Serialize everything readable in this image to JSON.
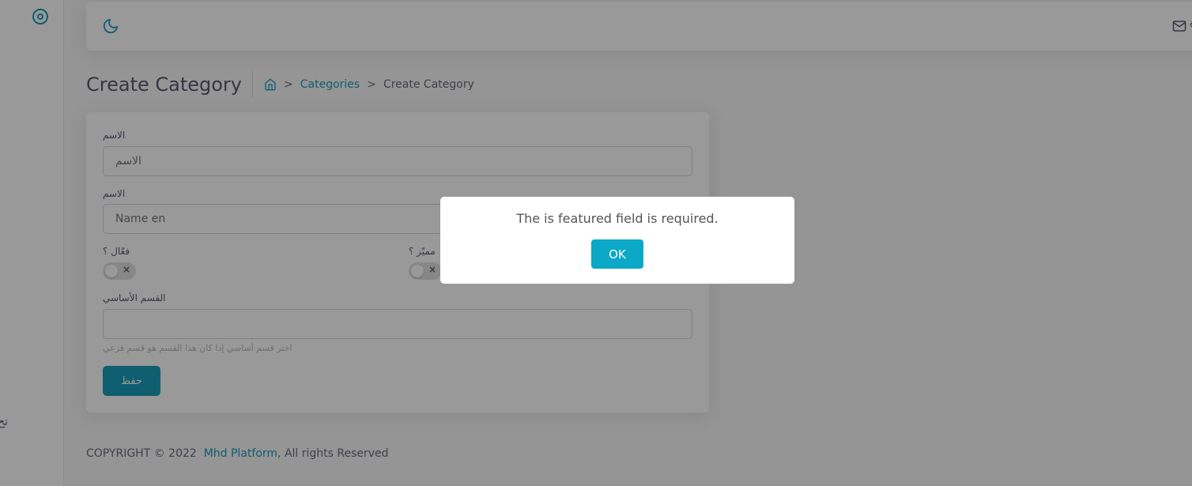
{
  "sidebar": {
    "partial_label": "تح"
  },
  "header": {
    "partial_label": "ة"
  },
  "page": {
    "title": "Create Category",
    "breadcrumb": {
      "sep1": ">",
      "categories": "Categories",
      "sep2": ">",
      "current": "Create Category"
    }
  },
  "form": {
    "name_ar_label": "الاسم",
    "name_ar_placeholder": "الاسم",
    "name_en_label": "الاسم",
    "name_en_placeholder": "Name en",
    "active_label": "فعّال ؟",
    "featured_label": "مميّز ؟",
    "toggle_off_symbol": "×",
    "parent_label": "القسم الأساسي",
    "parent_help": "اختر قسم أساسي إذا كان هذا القسم هو قسم فرعي",
    "save_label": "حفظ"
  },
  "footer": {
    "prefix": "COPYRIGHT © 2022",
    "brand": "Mhd Platform",
    "suffix": ", All rights Reserved"
  },
  "modal": {
    "message": "The is featured field is required.",
    "ok_label": "OK"
  },
  "colors": {
    "primary": "#1a9dba",
    "ok_button": "#0ba8c7"
  }
}
